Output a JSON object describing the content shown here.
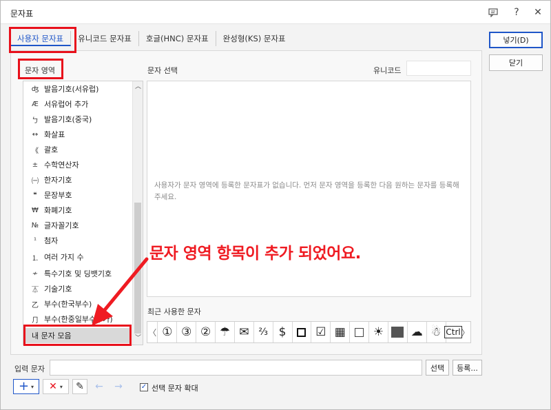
{
  "window": {
    "title": "문자표"
  },
  "titlebar_icons": {
    "chat": "speech-bubble-icon",
    "help": "?",
    "close": "✕"
  },
  "tabs": [
    {
      "label": "사용자 문자표",
      "active": true
    },
    {
      "label": "유니코드 문자표",
      "active": false
    },
    {
      "label": "호글(HNC) 문자표",
      "active": false
    },
    {
      "label": "완성형(KS) 문자표",
      "active": false
    }
  ],
  "sections": {
    "region": "문자 영역",
    "select": "문자 선택",
    "unicode": "유니코드",
    "recent": "최근 사용한 문자",
    "input": "입력 문자"
  },
  "region_list": [
    {
      "icon": "ʤ",
      "label": "발음기호(서유럽)"
    },
    {
      "icon": "Æ",
      "label": "서유럽어 추가"
    },
    {
      "icon": "ㄅ",
      "label": "발음기호(중국)"
    },
    {
      "icon": "↔",
      "label": "화살표"
    },
    {
      "icon": "《",
      "label": "괄호"
    },
    {
      "icon": "±",
      "label": "수학연산자"
    },
    {
      "icon": "㈠",
      "label": "한자기호"
    },
    {
      "icon": "❝",
      "label": "문장부호"
    },
    {
      "icon": "₩",
      "label": "화폐기호"
    },
    {
      "icon": "№",
      "label": "글자꼴기호"
    },
    {
      "icon": "¹",
      "label": "첨자"
    },
    {
      "icon": "⒈",
      "label": "여러 가지 수"
    },
    {
      "icon": "≁",
      "label": "특수기호 및 딩뱃기호"
    },
    {
      "icon": "⏄",
      "label": "기술기호"
    },
    {
      "icon": "乙",
      "label": "부수(한국부수)"
    },
    {
      "icon": "⺆",
      "label": "부수(한중일부수추가)"
    },
    {
      "icon": "",
      "label": "내 문자 모음"
    }
  ],
  "selected_region": "내 문자 모음",
  "char_select_message": "사용자가 문자 영역에 등록한 문자표가 없습니다. 먼저 문자 영역을 등록한 다음 원하는 문자를 등록해 주세요.",
  "recent_chars": [
    "①",
    "③",
    "②",
    "☂",
    "✉",
    "⅔",
    "$",
    "□",
    "☑",
    "▦",
    "□",
    "☀",
    "■",
    "☁",
    "☃",
    "Ctrl"
  ],
  "buttons": {
    "insert": "넣기(D)",
    "close": "닫기",
    "select": "선택",
    "register": "등록..."
  },
  "toolbar": {
    "add": "+",
    "delete": "✕",
    "edit": "✎",
    "back": "←",
    "forward": "→"
  },
  "checkbox": {
    "label": "선택 문자 확대",
    "checked": true
  },
  "annotation": "문자 영역 항목이 추가 되었어요.",
  "colors": {
    "accent": "#1e55c8",
    "annotation_red": "#ef1b22"
  }
}
